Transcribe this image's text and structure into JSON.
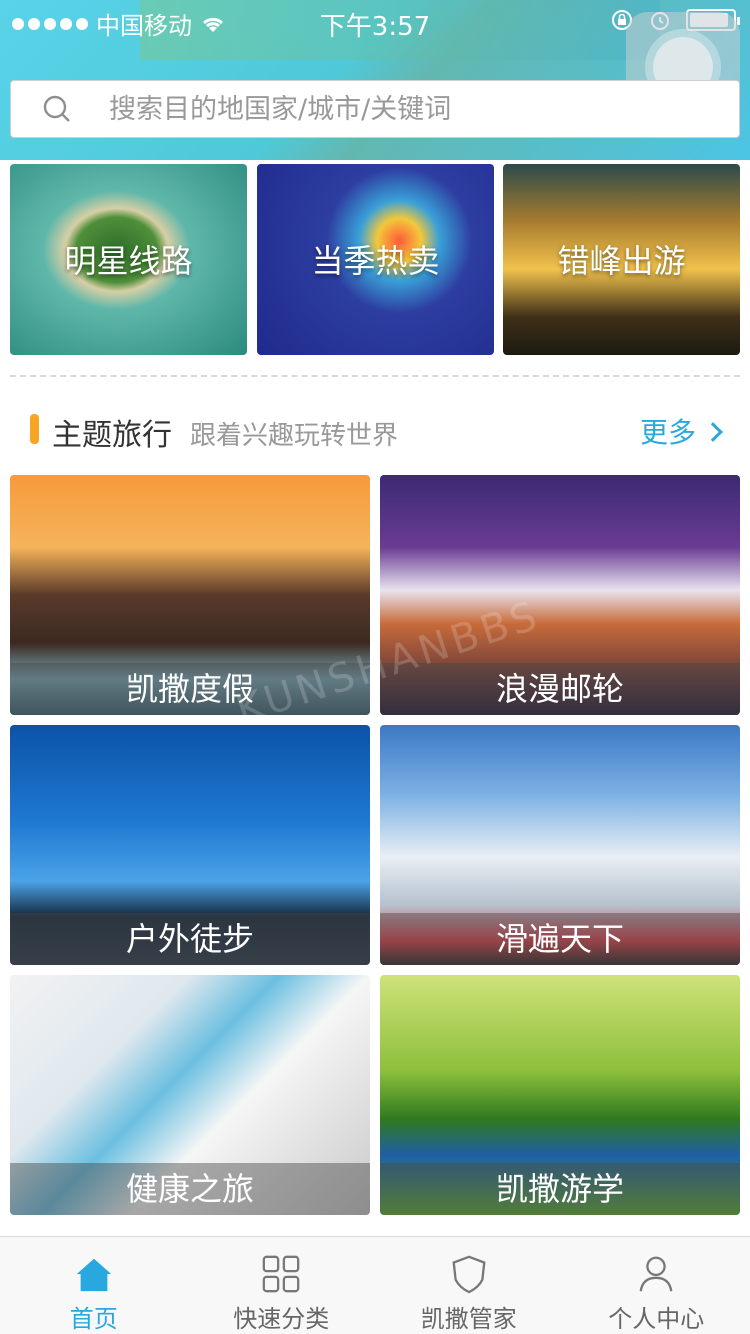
{
  "status": {
    "carrier": "中国移动",
    "time": "下午3:57"
  },
  "search": {
    "placeholder": "搜索目的地国家/城市/关键词"
  },
  "promos": [
    {
      "label": "明星线路"
    },
    {
      "label": "当季热卖"
    },
    {
      "label": "错峰出游"
    }
  ],
  "section": {
    "title": "主题旅行",
    "subtitle": "跟着兴趣玩转世界",
    "more": "更多"
  },
  "themes": [
    {
      "label": "凯撒度假"
    },
    {
      "label": "浪漫邮轮"
    },
    {
      "label": "户外徒步"
    },
    {
      "label": "滑遍天下"
    },
    {
      "label": "健康之旅"
    },
    {
      "label": "凯撒游学"
    }
  ],
  "watermark": "KUNSHANBBS",
  "tabs": [
    {
      "label": "首页",
      "icon": "home-icon",
      "active": true
    },
    {
      "label": "快速分类",
      "icon": "grid-icon",
      "active": false
    },
    {
      "label": "凯撒管家",
      "icon": "shield-icon",
      "active": false
    },
    {
      "label": "个人中心",
      "icon": "person-icon",
      "active": false
    }
  ],
  "colors": {
    "accent": "#29a8e0",
    "section_bar": "#f6a623"
  }
}
